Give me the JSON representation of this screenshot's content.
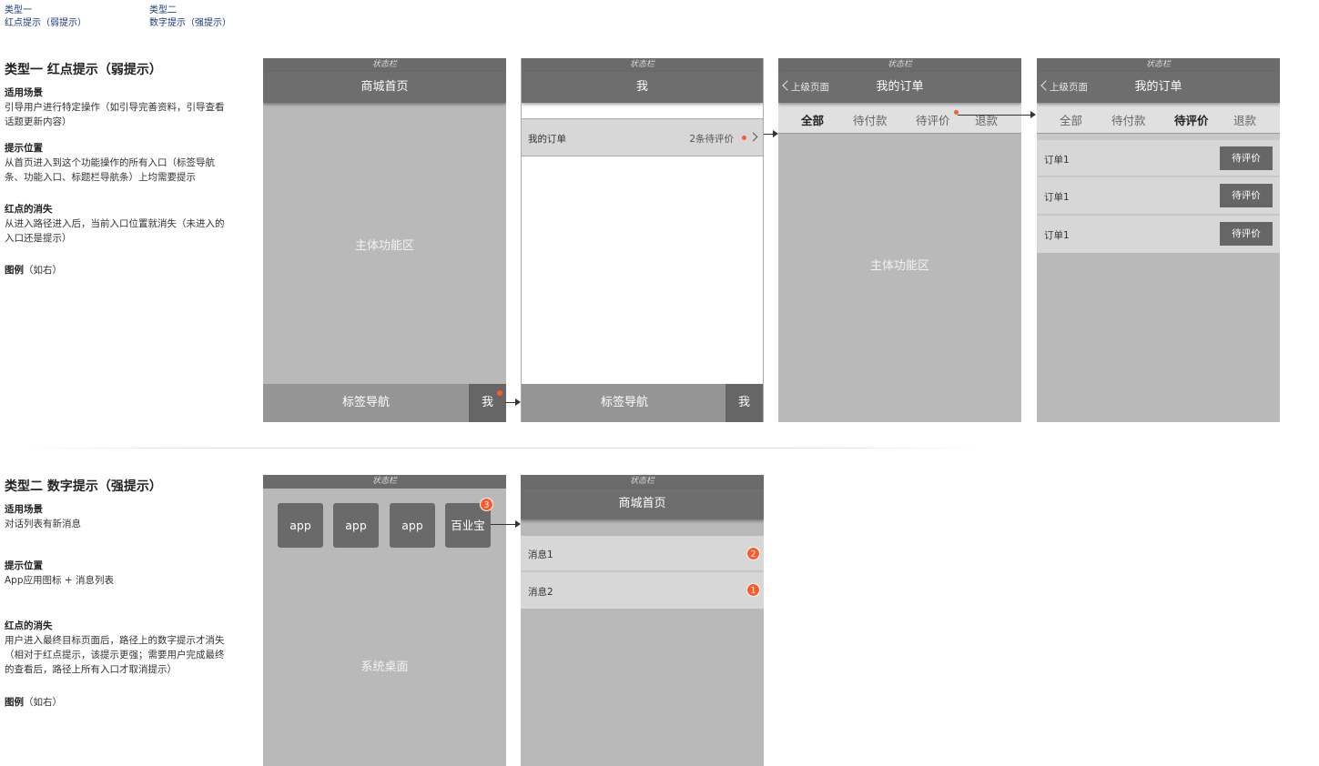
{
  "top_links": [
    {
      "line1": "类型一",
      "line2": "红点提示（弱提示）"
    },
    {
      "line1": "类型二",
      "line2": "数字提示（强提示）"
    }
  ],
  "section1": {
    "title": "类型一 红点提示（弱提示）",
    "scene_title": "适用场景",
    "scene_text": "引导用户进行特定操作（如引导完善资料，引导查看话题更新内容）",
    "position_title": "提示位置",
    "position_text": "从首页进入到这个功能操作的所有入口（标签导航条、功能入口、标题栏导航条）上均需要提示",
    "vanish_title": "红点的消失",
    "vanish_text": "从进入路径进入后，当前入口位置就消失（未进入的入口还是提示）",
    "legend_title": "图例",
    "legend_text": "（如右）"
  },
  "section2": {
    "title": "类型二 数字提示（强提示）",
    "scene_title": "适用场景",
    "scene_text": "对话列表有新消息",
    "position_title": "提示位置",
    "position_text": "App应用图标 + 消息列表",
    "vanish_title": "红点的消失",
    "vanish_text": "用户进入最终目标页面后，路径上的数字提示才消失（相对于红点提示，该提示更强；需要用户完成最终的查看后，路径上所有入口才取消提示）",
    "legend_title": "图例",
    "legend_text": "（如右）"
  },
  "status_bar": "状态栏",
  "phone1": {
    "title": "商城首页",
    "main": "主体功能区",
    "tab_label": "标签导航",
    "me": "我"
  },
  "phone2": {
    "title": "我",
    "row_label": "我的订单",
    "row_value": "2条待评价",
    "tab_label": "标签导航",
    "me": "我"
  },
  "phone3": {
    "back": "上级页面",
    "title": "我的订单",
    "tabs": [
      "全部",
      "待付款",
      "待评价",
      "退款"
    ],
    "main": "主体功能区"
  },
  "phone4": {
    "back": "上级页面",
    "title": "我的订单",
    "tabs": [
      "全部",
      "待付款",
      "待评价",
      "退款"
    ],
    "orders": [
      {
        "label": "订单1",
        "button": "待评价"
      },
      {
        "label": "订单1",
        "button": "待评价"
      },
      {
        "label": "订单1",
        "button": "待评价"
      }
    ]
  },
  "phone5": {
    "apps": [
      "app",
      "app",
      "app",
      "百业宝"
    ],
    "badge": "3",
    "main": "系统桌面"
  },
  "phone6": {
    "title": "商城首页",
    "messages": [
      {
        "label": "消息1",
        "count": "2"
      },
      {
        "label": "消息2",
        "count": "1"
      }
    ]
  },
  "colors": {
    "accent_dot": "#ff5a2a",
    "bar_dark": "#6e6e6e",
    "canvas_gray": "#b9b9b9"
  }
}
